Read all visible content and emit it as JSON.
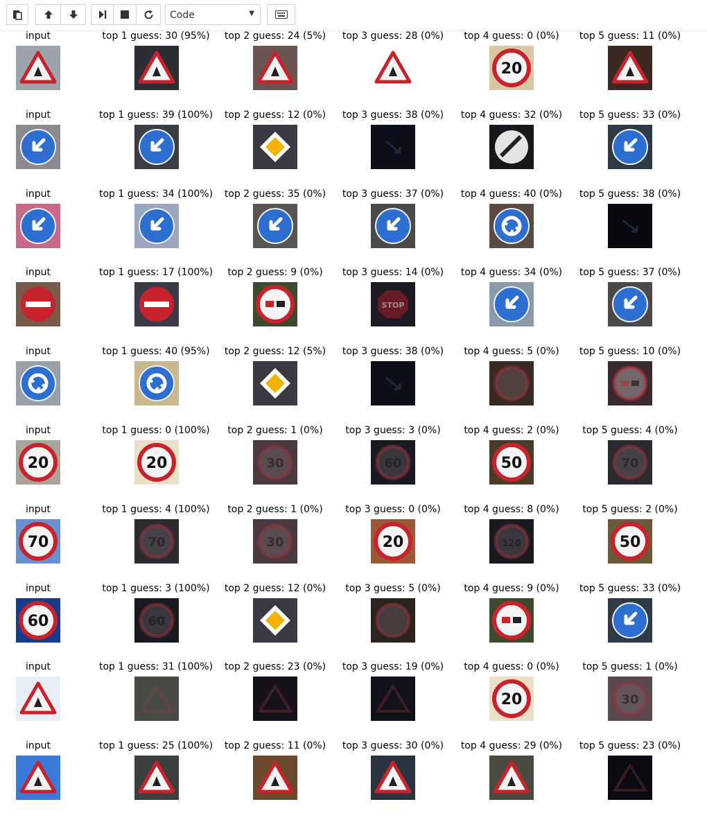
{
  "toolbar": {
    "cell_type": "Code",
    "icons": [
      "paste-icon",
      "move-up-icon",
      "move-down-icon",
      "run-icon",
      "stop-icon",
      "restart-icon",
      "keyboard-icon"
    ]
  },
  "rows": [
    {
      "input_label": "input",
      "guesses": [
        "top 1 guess: 30 (95%)",
        "top 2 guess: 24 (5%)",
        "top 3 guess: 28 (0%)",
        "top 4 guess: 0 (0%)",
        "top 5 guess: 11 (0%)"
      ]
    },
    {
      "input_label": "input",
      "guesses": [
        "top 1 guess: 39 (100%)",
        "top 2 guess: 12 (0%)",
        "top 3 guess: 38 (0%)",
        "top 4 guess: 32 (0%)",
        "top 5 guess: 33 (0%)"
      ]
    },
    {
      "input_label": "input",
      "guesses": [
        "top 1 guess: 34 (100%)",
        "top 2 guess: 35 (0%)",
        "top 3 guess: 37 (0%)",
        "top 4 guess: 40 (0%)",
        "top 5 guess: 38 (0%)"
      ]
    },
    {
      "input_label": "input",
      "guesses": [
        "top 1 guess: 17 (100%)",
        "top 2 guess: 9 (0%)",
        "top 3 guess: 14 (0%)",
        "top 4 guess: 34 (0%)",
        "top 5 guess: 37 (0%)"
      ]
    },
    {
      "input_label": "input",
      "guesses": [
        "top 1 guess: 40 (95%)",
        "top 2 guess: 12 (5%)",
        "top 3 guess: 38 (0%)",
        "top 4 guess: 5 (0%)",
        "top 5 guess: 10 (0%)"
      ]
    },
    {
      "input_label": "input",
      "guesses": [
        "top 1 guess: 0 (100%)",
        "top 2 guess: 1 (0%)",
        "top 3 guess: 3 (0%)",
        "top 4 guess: 2 (0%)",
        "top 5 guess: 4 (0%)"
      ]
    },
    {
      "input_label": "input",
      "guesses": [
        "top 1 guess: 4 (100%)",
        "top 2 guess: 1 (0%)",
        "top 3 guess: 0 (0%)",
        "top 4 guess: 8 (0%)",
        "top 5 guess: 2 (0%)"
      ]
    },
    {
      "input_label": "input",
      "guesses": [
        "top 1 guess: 3 (100%)",
        "top 2 guess: 12 (0%)",
        "top 3 guess: 5 (0%)",
        "top 4 guess: 9 (0%)",
        "top 5 guess: 33 (0%)"
      ]
    },
    {
      "input_label": "input",
      "guesses": [
        "top 1 guess: 31 (100%)",
        "top 2 guess: 23 (0%)",
        "top 3 guess: 19 (0%)",
        "top 4 guess: 0 (0%)",
        "top 5 guess: 1 (0%)"
      ]
    },
    {
      "input_label": "input",
      "guesses": [
        "top 1 guess: 25 (100%)",
        "top 2 guess: 11 (0%)",
        "top 3 guess: 30 (0%)",
        "top 4 guess: 29 (0%)",
        "top 5 guess: 23 (0%)"
      ]
    }
  ],
  "thumbnails": [
    [
      {
        "kind": "tri",
        "bg": "#9da3ad"
      },
      {
        "kind": "tri",
        "bg": "#2b2e33"
      },
      {
        "kind": "tri",
        "bg": "#6b5550"
      },
      {
        "kind": "tri",
        "bg": "#ffffff"
      },
      {
        "kind": "limit",
        "text": "20",
        "bg": "#d7c7a3"
      },
      {
        "kind": "tri",
        "bg": "#3a2a22"
      }
    ],
    [
      {
        "kind": "blue-arrow",
        "bg": "#8a8a90"
      },
      {
        "kind": "blue-arrow",
        "bg": "#3b3d44"
      },
      {
        "kind": "diamond",
        "bg": "#3a3a44"
      },
      {
        "kind": "dark",
        "bg": "#0d0f18"
      },
      {
        "kind": "end",
        "bg": "#17181c"
      },
      {
        "kind": "blue-arrow",
        "bg": "#2e3a48"
      }
    ],
    [
      {
        "kind": "blue-arrow",
        "bg": "#c76a8a"
      },
      {
        "kind": "blue-arrow",
        "bg": "#9aa6c0"
      },
      {
        "kind": "blue-arrow",
        "bg": "#5a5552"
      },
      {
        "kind": "blue-arrow",
        "bg": "#4a4a48"
      },
      {
        "kind": "round",
        "bg": "#5a4a40"
      },
      {
        "kind": "dark",
        "bg": "#08080f"
      }
    ],
    [
      {
        "kind": "noentry",
        "bg": "#7a5a4a"
      },
      {
        "kind": "noentry",
        "bg": "#3a3a48"
      },
      {
        "kind": "nopass",
        "bg": "#3d4a2e"
      },
      {
        "kind": "stop",
        "bg": "#1f1a22"
      },
      {
        "kind": "blue-arrow",
        "bg": "#8a9aaa"
      },
      {
        "kind": "blue-arrow",
        "bg": "#4a4a48"
      }
    ],
    [
      {
        "kind": "round",
        "bg": "#9aa0aa"
      },
      {
        "kind": "round",
        "bg": "#c8b890"
      },
      {
        "kind": "diamond",
        "bg": "#3a3a44"
      },
      {
        "kind": "dark",
        "bg": "#0d0f18"
      },
      {
        "kind": "limit-dim",
        "text": "",
        "bg": "#3a2a22"
      },
      {
        "kind": "nopass-dim",
        "bg": "#3a2a30"
      }
    ],
    [
      {
        "kind": "limit",
        "text": "20",
        "bg": "#aaa49a"
      },
      {
        "kind": "limit",
        "text": "20",
        "bg": "#eae0c8"
      },
      {
        "kind": "limit-dim",
        "text": "30",
        "bg": "#4a3a40"
      },
      {
        "kind": "limit-dim",
        "text": "60",
        "bg": "#1a1a22"
      },
      {
        "kind": "limit",
        "text": "50",
        "bg": "#4a3a2a"
      },
      {
        "kind": "limit-dim",
        "text": "70",
        "bg": "#2a2a30"
      }
    ],
    [
      {
        "kind": "limit",
        "text": "70",
        "bg": "#6a90d0"
      },
      {
        "kind": "limit-dim",
        "text": "70",
        "bg": "#2a2a30"
      },
      {
        "kind": "limit-dim",
        "text": "30",
        "bg": "#4a3a40"
      },
      {
        "kind": "limit",
        "text": "20",
        "bg": "#9a5a3a"
      },
      {
        "kind": "limit-dim",
        "text": "120",
        "bg": "#1a1a22"
      },
      {
        "kind": "limit",
        "text": "50",
        "bg": "#6a5a3a"
      }
    ],
    [
      {
        "kind": "limit",
        "text": "60",
        "bg": "#1a3a8a"
      },
      {
        "kind": "limit-dim",
        "text": "60",
        "bg": "#1a1a22"
      },
      {
        "kind": "diamond",
        "bg": "#3a3a44"
      },
      {
        "kind": "limit-dim",
        "text": "",
        "bg": "#2a2420"
      },
      {
        "kind": "nopass",
        "bg": "#3d4a2e"
      },
      {
        "kind": "blue-arrow",
        "bg": "#2e3a48"
      }
    ],
    [
      {
        "kind": "tri",
        "bg": "#e8eef5"
      },
      {
        "kind": "tri-dim",
        "bg": "#4a4a44"
      },
      {
        "kind": "tri-dim",
        "bg": "#15121a"
      },
      {
        "kind": "tri-dim",
        "bg": "#12101a"
      },
      {
        "kind": "limit",
        "text": "20",
        "bg": "#eae0c8"
      },
      {
        "kind": "limit-dim",
        "text": "30",
        "bg": "#5a4a50"
      }
    ],
    [
      {
        "kind": "tri",
        "bg": "#3a7ad8"
      },
      {
        "kind": "tri",
        "bg": "#3a4040"
      },
      {
        "kind": "tri",
        "bg": "#6a4a2a"
      },
      {
        "kind": "tri",
        "bg": "#2a3340"
      },
      {
        "kind": "tri",
        "bg": "#4a4a40"
      },
      {
        "kind": "tri-dim",
        "bg": "#0a0a10"
      }
    ]
  ]
}
